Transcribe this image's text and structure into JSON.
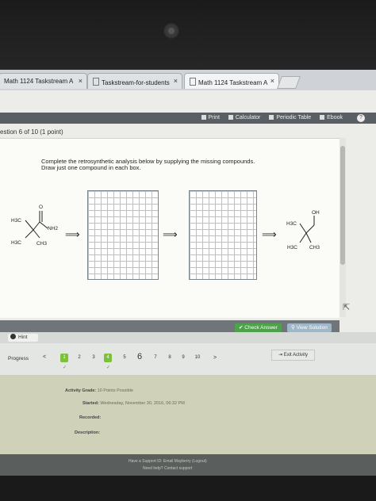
{
  "browser": {
    "tabs": [
      {
        "label": "Math 1124 Taskstream A",
        "close": "×"
      },
      {
        "label": "Taskstream-for-students",
        "close": "×"
      },
      {
        "label": "Math 1124 Taskstream A",
        "close": "×"
      }
    ]
  },
  "toolbar": {
    "items": [
      "Print",
      "Calculator",
      "Periodic Table",
      "Ebook"
    ],
    "help": "?"
  },
  "question": {
    "header": "estion 6 of 10 (1 point)",
    "instruction_line1": "Complete the retrosynthetic analysis below by supplying the missing compounds.",
    "instruction_line2": "Draw just one compound in each box.",
    "arrow": "⟹",
    "start_labels": {
      "h3c_top": "H3C",
      "o": "O",
      "nh2": "NH2",
      "h3c_bottom": "H3C",
      "ch3": "CH3"
    },
    "end_labels": {
      "oh": "OH",
      "h3c_top": "H3C",
      "h3c_bottom": "H3C",
      "ch3": "CH3"
    }
  },
  "actions": {
    "check": "Check Answer",
    "solution": "View Solution",
    "hint": "Hint",
    "exit": "Exit Activity"
  },
  "progress": {
    "label": "Progress",
    "prev": "<",
    "next": ">",
    "pages": [
      "1",
      "2",
      "3",
      "4",
      "5",
      "6",
      "7",
      "8",
      "9",
      "10"
    ],
    "done_pages": [
      "1",
      "4"
    ],
    "current": "6",
    "tick": "✓"
  },
  "grade": {
    "activity_grade_label": "Activity Grade:",
    "activity_grade_value": "10 Points Possible",
    "started_label": "Started:",
    "started_value": "Wednesday, November 30, 2016, 06:32 PM",
    "recorded_label": "Recorded:",
    "description_label": "Description:"
  },
  "footer": {
    "line1": "Have a Support ID: Email Mayberry (Logout)",
    "line2": "Need help? Contact support"
  },
  "colors": {
    "check": "#4ea24a",
    "done": "#7cc13b",
    "grade_bg": "#cfd2b9"
  }
}
